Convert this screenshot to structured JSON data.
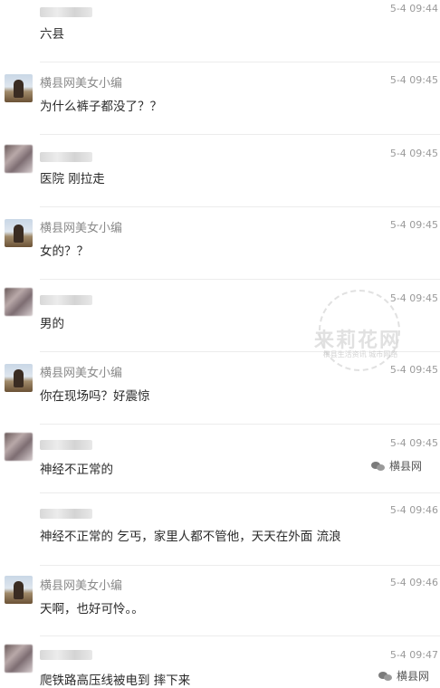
{
  "messages": [
    {
      "type": "blur",
      "name": "",
      "time": "5-4 09:44",
      "text": "六县"
    },
    {
      "type": "editor",
      "name": "横县网美女小编",
      "time": "5-4 09:45",
      "text": "为什么裤子都没了？？"
    },
    {
      "type": "blur",
      "name": "",
      "time": "5-4 09:45",
      "text": "医院 刚拉走"
    },
    {
      "type": "editor",
      "name": "横县网美女小编",
      "time": "5-4 09:45",
      "text": "女的？？"
    },
    {
      "type": "blur",
      "name": "",
      "time": "5-4 09:45",
      "text": "男的"
    },
    {
      "type": "editor",
      "name": "横县网美女小编",
      "time": "5-4 09:45",
      "text": "你在现场吗？好震惊"
    },
    {
      "type": "blur",
      "name": "",
      "time": "5-4 09:45",
      "text": "神经不正常的"
    },
    {
      "type": "blur",
      "name": "",
      "time": "5-4 09:46",
      "text": "神经不正常的 乞丐，家里人都不管他，天天在外面 流浪"
    },
    {
      "type": "editor",
      "name": "横县网美女小编",
      "time": "5-4 09:46",
      "text": "天啊，也好可怜。。"
    },
    {
      "type": "blur",
      "name": "",
      "time": "5-4 09:47",
      "text": "爬铁路高压线被电到  摔下来"
    }
  ],
  "watermark": {
    "main": "来莉花网",
    "sub": "横县生活资讯 城市网络"
  },
  "brand": {
    "label": "横县网",
    "label2": "横县网"
  }
}
